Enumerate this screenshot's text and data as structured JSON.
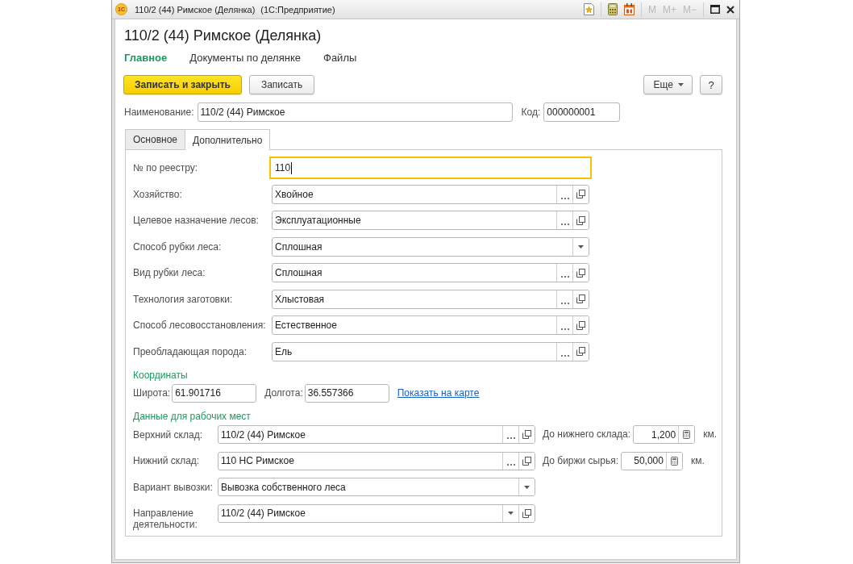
{
  "window": {
    "logo": "1С",
    "title": "110/2 (44) Римское (Делянка)",
    "app": "(1С:Предприятие)",
    "memory_buttons": [
      {
        "label": "M",
        "disabled": true
      },
      {
        "label": "M+",
        "disabled": true
      },
      {
        "label": "M−",
        "disabled": true
      }
    ]
  },
  "form": {
    "title": "110/2 (44) Римское (Делянка)",
    "sections": [
      {
        "label": "Главное",
        "selected": true
      },
      {
        "label": "Документы по делянке",
        "selected": false
      },
      {
        "label": "Файлы",
        "selected": false
      }
    ],
    "command_bar": {
      "buttons": [
        {
          "label": "Записать и закрыть",
          "kind": "primary"
        },
        {
          "label": "Записать",
          "kind": "default"
        }
      ],
      "more": "Еще",
      "help": "?"
    },
    "name": {
      "label": "Наименование:",
      "value": "110/2 (44) Римское"
    },
    "code": {
      "label": "Код:",
      "value": "000000001"
    },
    "tabs": [
      {
        "label": "Основное",
        "selected": false
      },
      {
        "label": "Дополнительно",
        "selected": true
      }
    ],
    "fields": [
      {
        "label": "№ по реестру:",
        "value": "110",
        "kind": "text",
        "focused": true
      },
      {
        "label": "Хозяйство:",
        "value": "Хвойное",
        "kind": "choice",
        "focused": false
      },
      {
        "label": "Целевое назначение лесов:",
        "value": "Эксплуатационные",
        "kind": "choice",
        "focused": false
      },
      {
        "label": "Способ рубки леса:",
        "value": "Сплошная",
        "kind": "dropdown",
        "focused": false
      },
      {
        "label": "Вид рубки леса:",
        "value": "Сплошная",
        "kind": "choice",
        "focused": false
      },
      {
        "label": "Технология заготовки:",
        "value": "Хлыстовая",
        "kind": "choice",
        "focused": false
      },
      {
        "label": "Способ лесовосстановления:",
        "value": "Естественное",
        "kind": "choice",
        "focused": false
      },
      {
        "label": "Преобладающая порода:",
        "value": "Ель",
        "kind": "choice",
        "focused": false
      }
    ],
    "coordinates": {
      "title": "Координаты",
      "fields": [
        {
          "label": "Широта:",
          "value": "61.901716"
        },
        {
          "label": "Долгота:",
          "value": "36.557366"
        }
      ],
      "map_link": "Показать на карте"
    },
    "workplace": {
      "title": "Данные для рабочих мест",
      "rows": [
        {
          "label": "Верхний склад:",
          "value": "110/2 (44) Римское",
          "kind": "choice",
          "distance": {
            "label": "До нижнего склада:",
            "value": "1,200",
            "unit": "км."
          }
        },
        {
          "label": "Нижний склад:",
          "value": "110 НС Римское",
          "kind": "choice",
          "distance": {
            "label": "До биржи сырья:",
            "value": "50,000",
            "unit": "км."
          }
        },
        {
          "label": "Вариант вывозки:",
          "value": "Вывозка собственного леса",
          "kind": "dropdown"
        },
        {
          "label": "Направление деятельности:",
          "value": "110/2 (44) Римское",
          "kind": "dropdown_open"
        }
      ]
    }
  }
}
